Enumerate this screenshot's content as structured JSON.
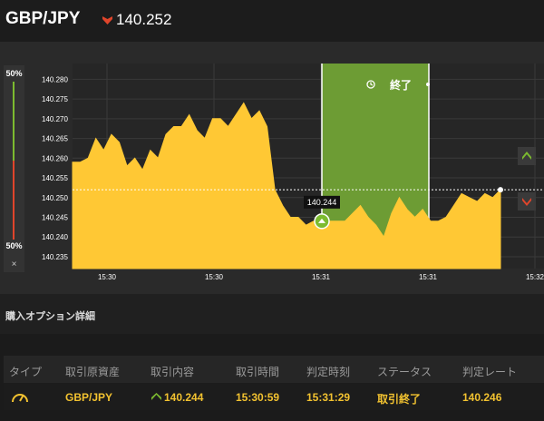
{
  "header": {
    "pair": "GBP/JPY",
    "price": "140.252",
    "direction": "down",
    "down_color": "#e0452b"
  },
  "ratio": {
    "top_label": "50%",
    "bottom_label": "50%",
    "close_label": "×",
    "up_fraction": 0.5
  },
  "chart": {
    "y_ticks": [
      "140.280",
      "140.275",
      "140.270",
      "140.265",
      "140.260",
      "140.255",
      "140.250",
      "140.245",
      "140.240",
      "140.235"
    ],
    "x_ticks": [
      "15:30",
      "15:30",
      "15:31",
      "15:31",
      "15:32"
    ],
    "entry_label": "140.244",
    "window_label": "終了",
    "fill_color": "#ffc834",
    "window_color": "#6d9c34",
    "current_price": 140.252
  },
  "chart_data": {
    "type": "area",
    "ylim": [
      140.232,
      140.284
    ],
    "y_ticks": [
      140.28,
      140.275,
      140.27,
      140.265,
      140.26,
      140.255,
      140.25,
      140.245,
      140.24,
      140.235
    ],
    "values": [
      140.259,
      140.259,
      140.26,
      140.265,
      140.262,
      140.266,
      140.264,
      140.258,
      140.26,
      140.257,
      140.262,
      140.26,
      140.266,
      140.268,
      140.268,
      140.271,
      140.267,
      140.265,
      140.27,
      140.27,
      140.268,
      140.271,
      140.274,
      140.27,
      140.272,
      140.268,
      140.252,
      140.248,
      140.245,
      140.245,
      140.243,
      140.244,
      140.244,
      140.244,
      140.244,
      140.244,
      140.246,
      140.248,
      140.245,
      140.243,
      140.24,
      140.246,
      140.25,
      140.247,
      140.245,
      140.247,
      140.244,
      140.244,
      140.245,
      140.248,
      140.251,
      140.25,
      140.249,
      140.251,
      140.25,
      140.252
    ],
    "entry_value": 140.244,
    "current_value": 140.252
  },
  "details": {
    "title": "購入オプション詳細",
    "headers": [
      "タイプ",
      "取引原資産",
      "取引内容",
      "取引時間",
      "判定時刻",
      "ステータス",
      "判定レート"
    ],
    "row": {
      "asset": "GBP/JPY",
      "content": "140.244",
      "trade_time": "15:30:59",
      "judge_time": "15:31:29",
      "status": "取引終了",
      "rate": "140.246"
    }
  }
}
